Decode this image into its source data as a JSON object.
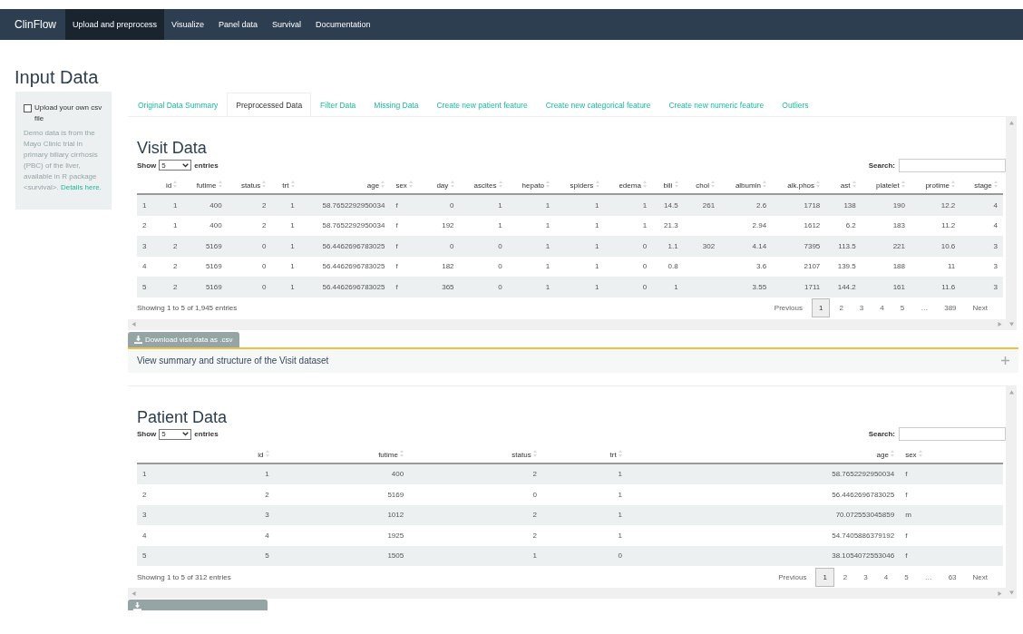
{
  "navbar": {
    "brand": "ClinFlow",
    "items": [
      {
        "label": "Upload and preprocess",
        "selected": true
      },
      {
        "label": "Visualize",
        "selected": false
      },
      {
        "label": "Panel data",
        "selected": false
      },
      {
        "label": "Survival",
        "selected": false
      },
      {
        "label": "Documentation",
        "selected": false
      }
    ]
  },
  "page_title": "Input Data",
  "sidebar": {
    "upload_checkbox": {
      "label": "Upload your own csv file",
      "checked": false
    },
    "description": "Demo data is from the Mayo Clinic trial in primary biliary cirrhosis (PBC) of the liver, available in R package <survival>.",
    "link": "Details here."
  },
  "tabs": [
    {
      "label": "Original Data Summary",
      "selected": false
    },
    {
      "label": "Preprocessed Data",
      "selected": true
    },
    {
      "label": "Filter Data",
      "selected": false
    },
    {
      "label": "Missing Data",
      "selected": false
    },
    {
      "label": "Create new patient feature",
      "selected": false
    },
    {
      "label": "Create new categorical feature",
      "selected": false
    },
    {
      "label": "Create new numeric feature",
      "selected": false
    },
    {
      "label": "Outliers",
      "selected": false
    }
  ],
  "visit_table": {
    "title": "Visit Data",
    "show_label": "Show",
    "page_size": "5",
    "entries_label": "entries",
    "search_label": "Search:",
    "columns": [
      {
        "kind": "index"
      },
      {
        "label": "id",
        "kind": "number"
      },
      {
        "label": "futime",
        "kind": "number"
      },
      {
        "label": "status",
        "kind": "number"
      },
      {
        "label": "trt",
        "kind": "number"
      },
      {
        "label": "age",
        "kind": "number"
      },
      {
        "label": "sex",
        "kind": "text"
      },
      {
        "label": "day",
        "kind": "number"
      },
      {
        "label": "ascites",
        "kind": "number"
      },
      {
        "label": "hepato",
        "kind": "number"
      },
      {
        "label": "spiders",
        "kind": "number"
      },
      {
        "label": "edema",
        "kind": "number"
      },
      {
        "label": "bili",
        "kind": "number"
      },
      {
        "label": "chol",
        "kind": "number"
      },
      {
        "label": "albumin",
        "kind": "number"
      },
      {
        "label": "alk.phos",
        "kind": "number"
      },
      {
        "label": "ast",
        "kind": "number"
      },
      {
        "label": "platelet",
        "kind": "number"
      },
      {
        "label": "protime",
        "kind": "number"
      },
      {
        "label": "stage",
        "kind": "number"
      }
    ],
    "rows": [
      [
        "1",
        "1",
        "400",
        "2",
        "1",
        "58.7652292950034",
        "f",
        "0",
        "1",
        "1",
        "1",
        "1",
        "14.5",
        "261",
        "2.6",
        "1718",
        "138",
        "190",
        "12.2",
        "4"
      ],
      [
        "2",
        "1",
        "400",
        "2",
        "1",
        "58.7652292950034",
        "f",
        "192",
        "1",
        "1",
        "1",
        "1",
        "21.3",
        "",
        "2.94",
        "1612",
        "6.2",
        "183",
        "11.2",
        "4"
      ],
      [
        "3",
        "2",
        "5169",
        "0",
        "1",
        "56.4462696783025",
        "f",
        "0",
        "0",
        "1",
        "1",
        "0",
        "1.1",
        "302",
        "4.14",
        "7395",
        "113.5",
        "221",
        "10.6",
        "3"
      ],
      [
        "4",
        "2",
        "5169",
        "0",
        "1",
        "56.4462696783025",
        "f",
        "182",
        "0",
        "1",
        "1",
        "0",
        "0.8",
        "",
        "3.6",
        "2107",
        "139.5",
        "188",
        "11",
        "3"
      ],
      [
        "5",
        "2",
        "5169",
        "0",
        "1",
        "56.4462696783025",
        "f",
        "365",
        "0",
        "1",
        "1",
        "0",
        "1",
        "",
        "3.55",
        "1711",
        "144.2",
        "161",
        "11.6",
        "3"
      ]
    ],
    "info": "Showing 1 to 5 of 1,945 entries",
    "previous": "Previous",
    "next": "Next",
    "pages": [
      {
        "label": "1",
        "selected": true
      },
      {
        "label": "2",
        "selected": false
      },
      {
        "label": "3",
        "selected": false
      },
      {
        "label": "4",
        "selected": false
      },
      {
        "label": "5",
        "selected": false
      },
      {
        "label": "…",
        "selected": false
      },
      {
        "label": "389",
        "selected": false
      }
    ],
    "download_button": "Download visit data as .csv",
    "summary": "View summary and structure of the Visit dataset"
  },
  "patient_table": {
    "title": "Patient Data",
    "show_label": "Show",
    "page_size": "5",
    "entries_label": "entries",
    "search_label": "Search:",
    "columns": [
      {
        "kind": "index"
      },
      {
        "label": "id",
        "kind": "number"
      },
      {
        "label": "futime",
        "kind": "number"
      },
      {
        "label": "status",
        "kind": "number"
      },
      {
        "label": "trt",
        "kind": "number"
      },
      {
        "label": "age",
        "kind": "number"
      },
      {
        "label": "sex",
        "kind": "text"
      }
    ],
    "rows": [
      [
        "1",
        "1",
        "400",
        "2",
        "1",
        "58.7652292950034",
        "f"
      ],
      [
        "2",
        "2",
        "5169",
        "0",
        "1",
        "56.4462696783025",
        "f"
      ],
      [
        "3",
        "3",
        "1012",
        "2",
        "1",
        "70.072553045859",
        "m"
      ],
      [
        "4",
        "4",
        "1925",
        "2",
        "1",
        "54.7405886379192",
        "f"
      ],
      [
        "5",
        "5",
        "1505",
        "1",
        "0",
        "38.1054072553046",
        "f"
      ]
    ],
    "info": "Showing 1 to 5 of 312 entries",
    "previous": "Previous",
    "next": "Next",
    "pages": [
      {
        "label": "1",
        "selected": true
      },
      {
        "label": "2",
        "selected": false
      },
      {
        "label": "3",
        "selected": false
      },
      {
        "label": "4",
        "selected": false
      },
      {
        "label": "5",
        "selected": false
      },
      {
        "label": "…",
        "selected": false
      },
      {
        "label": "63",
        "selected": false
      }
    ]
  }
}
